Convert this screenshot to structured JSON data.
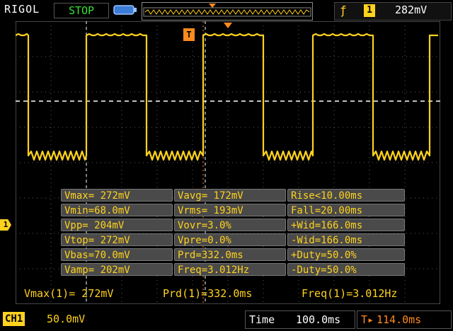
{
  "topbar": {
    "brand": "RIGOL",
    "status": "STOP",
    "trigger_edge_glyph": "ƒ",
    "trigger_channel": "1",
    "trigger_level": "282mV"
  },
  "measurements": [
    [
      "Vmax= 272mV",
      "Vavg= 172mV",
      "Rise<10.00ms"
    ],
    [
      "Vmin=68.0mV",
      "Vrms= 193mV",
      "Fall=20.00ms"
    ],
    [
      "Vpp= 204mV",
      "Vovr=3.0%",
      "+Wid=166.0ms"
    ],
    [
      "Vtop= 272mV",
      "Vpre=0.0%",
      "-Wid=166.0ms"
    ],
    [
      "Vbas=70.0mV",
      "Prd=332.0ms",
      "+Duty=50.0%"
    ],
    [
      "Vamp= 202mV",
      "Freq=3.012Hz",
      "-Duty=50.0%"
    ]
  ],
  "summary": {
    "vmax": "Vmax(1)= 272mV",
    "prd": "Prd(1)=332.0ms",
    "freq": "Freq(1)=3.012Hz"
  },
  "footer": {
    "ch1_label": "CH1",
    "ch1_scale": "50.0mV",
    "time_label": "Time",
    "time_value": "100.0ms",
    "trigger_pos": "114.0ms"
  },
  "markers": {
    "ch1": "1",
    "trigger": "T"
  },
  "colors": {
    "trace": "#ffd21e",
    "status": "#34e134",
    "trigger": "#ff8a1e"
  },
  "icons": {
    "battery": "battery-icon",
    "trigger_edge": "rising-edge-icon"
  }
}
